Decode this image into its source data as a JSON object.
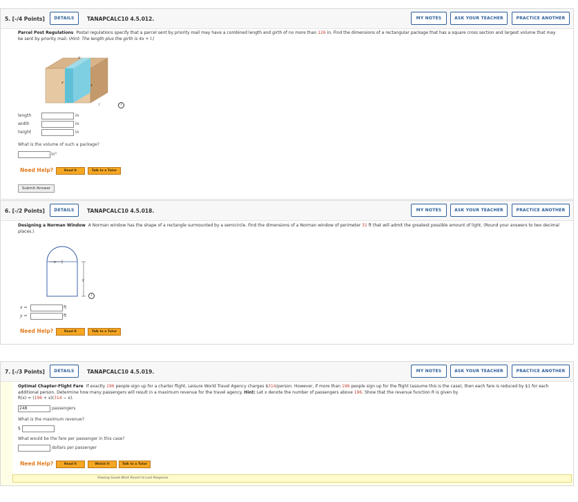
{
  "buttons": {
    "details": "DETAILS",
    "my_notes": "MY NOTES",
    "ask_teacher": "ASK YOUR TEACHER",
    "practice": "PRACTICE ANOTHER"
  },
  "help": {
    "need_help": "Need Help?",
    "read_it": "Read It",
    "watch_it": "Watch It",
    "talk_tutor": "Talk to a Tutor"
  },
  "q5": {
    "num": "5. [-/4 Points]",
    "id": "TANAPCALC10 4.5.012.",
    "title": "Parcel Post Regulations",
    "text_a": "Postal regulations specify that a parcel sent by priority mail may have a combined length and girth of no more than ",
    "limit": "126",
    "text_b": " in. Find the dimensions of a rectangular package that has a square cross section and largest volume that may be sent by priority mail. (",
    "hint_label": "Hint:",
    "hint_text": " The length plus the girth is 4x + l.)",
    "fig_x1": "x",
    "fig_x2": "x",
    "fig_x3": "x",
    "fig_l": "l",
    "fields": [
      {
        "label": "length",
        "unit": "in"
      },
      {
        "label": "width",
        "unit": "in"
      },
      {
        "label": "height",
        "unit": "in"
      }
    ],
    "volume_q": "What is the volume of such a package?",
    "volume_unit": "in³",
    "submit": "Submit Answer"
  },
  "q6": {
    "num": "6. [-/2 Points]",
    "id": "TANAPCALC10 4.5.018.",
    "title": "Designing a Norman Window",
    "text_a": "A Norman window has the shape of a rectangle surmounted by a semicircle. Find the dimensions of a Norman window of perimeter ",
    "perimeter": "31",
    "text_b": " ft that will admit the greatest possible amount of light. (Round your answers to two decimal places.)",
    "fig_x": "x",
    "fig_y": "y",
    "x_label": "x =",
    "y_label": "y =",
    "unit": "ft"
  },
  "q7": {
    "num": "7. [-/3 Points]",
    "id": "TANAPCALC10 4.5.019.",
    "title": "Optimal Chapter-Flight Fare",
    "text_a": "If exactly ",
    "n1": "196",
    "text_b": " people sign up for a charter flight, Leisure World Travel Agency charges $",
    "price": "314",
    "text_c": "/person. However, if more than ",
    "n2": "196",
    "text_d": " people sign up for the flight (assume this is the case), then each fare is reduced by $1 for each additional person. Determine how many passengers will result in a maximum revenue for the travel agency. ",
    "hint_label": "Hint:",
    "text_e": " Let x denote the number of passengers above ",
    "n3": "196",
    "text_f": ". Show that the revenue function R is given by",
    "rx_a": "R(x) = (",
    "rx_n1": "196",
    "rx_b": " + x)(",
    "rx_n2": "314",
    "rx_c": " − x).",
    "answer_value": "248",
    "answer_unit": "passengers",
    "rev_q": "What is the maximum revenue?",
    "dollar": "$",
    "fare_q": "What would be the fare per passenger in this case?",
    "fare_unit": "dollars per passenger",
    "saved_note": "Viewing Saved Work Revert to Last Response"
  }
}
